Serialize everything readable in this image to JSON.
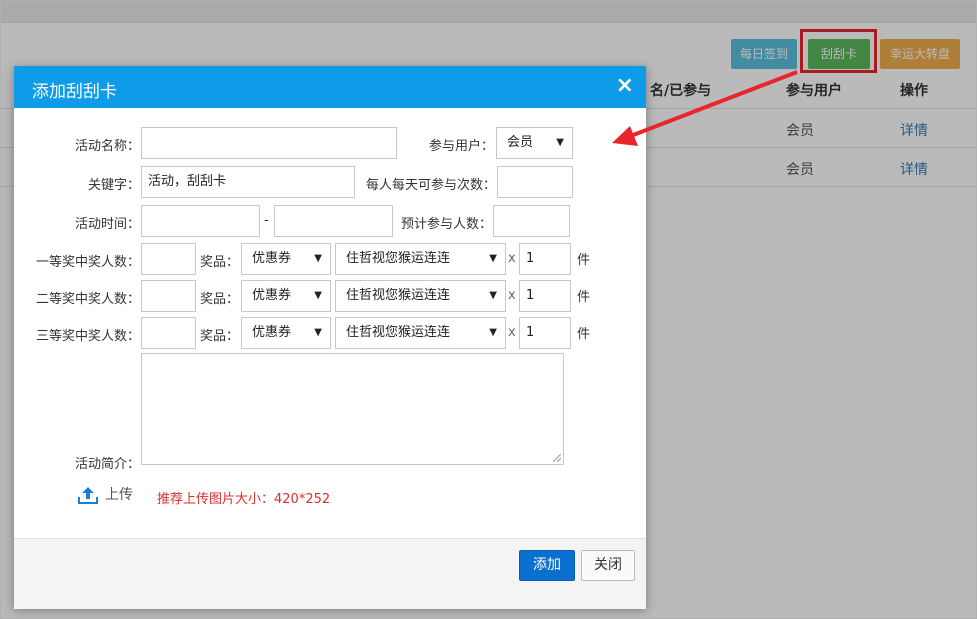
{
  "background": {
    "buttons": {
      "daily_signin": "每日签到",
      "scratch_card": "刮刮卡",
      "lucky_wheel": "幸运大转盘"
    },
    "table": {
      "headers": [
        "名/已参与",
        "参与用户",
        "操作"
      ],
      "rows": [
        {
          "user": "会员",
          "action": "详情"
        },
        {
          "user": "会员",
          "action": "详情"
        }
      ]
    }
  },
  "modal": {
    "title": "添加刮刮卡",
    "close_symbol": "×",
    "fields": {
      "activity_name_label": "活动名称：",
      "participant_label": "参与用户：",
      "participant_value": "会员",
      "keyword_label": "关键字：",
      "keyword_value": "活动，刮刮卡",
      "daily_times_label": "每人每天可参与次数：",
      "activity_time_label": "活动时间：",
      "time_separator": "-",
      "expected_people_label": "预计参与人数："
    },
    "prizes": [
      {
        "label": "一等奖中奖人数：",
        "prize_label": "奖品：",
        "type": "优惠券",
        "item": "住哲视您猴运连连",
        "multiply": "x",
        "quantity": "1",
        "unit": "件"
      },
      {
        "label": "二等奖中奖人数：",
        "prize_label": "奖品：",
        "type": "优惠券",
        "item": "住哲视您猴运连连",
        "multiply": "x",
        "quantity": "1",
        "unit": "件"
      },
      {
        "label": "三等奖中奖人数：",
        "prize_label": "奖品：",
        "type": "优惠券",
        "item": "住哲视您猴运连连",
        "multiply": "x",
        "quantity": "1",
        "unit": "件"
      }
    ],
    "intro_label": "活动简介：",
    "upload_label": "上传",
    "upload_hint": "推荐上传图片大小：420*252",
    "buttons": {
      "add": "添加",
      "close": "关闭"
    }
  },
  "colors": {
    "header": "#0e9be8",
    "primary_button": "#0b6fd0",
    "hint": "#d9302c",
    "highlight": "#e8262b"
  }
}
